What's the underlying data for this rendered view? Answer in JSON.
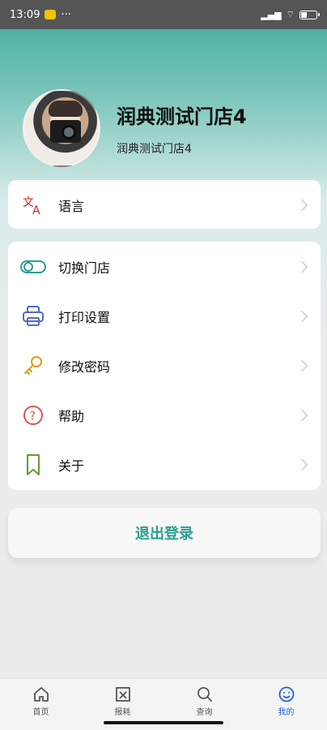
{
  "status_bar": {
    "time": "13:09",
    "dots": "···",
    "right_text": "",
    "battery_level": 0.4
  },
  "profile": {
    "title": "润典测试门店4",
    "subtitle": "润典测试门店4"
  },
  "language_item": {
    "label": "语言",
    "icon": "language-icon"
  },
  "menu": {
    "items": [
      {
        "label": "切换门店",
        "icon": "switch-icon"
      },
      {
        "label": "打印设置",
        "icon": "printer-icon"
      },
      {
        "label": "修改密码",
        "icon": "key-icon"
      },
      {
        "label": "帮助",
        "icon": "help-icon"
      },
      {
        "label": "关于",
        "icon": "bookmark-icon"
      }
    ]
  },
  "logout": {
    "label": "退出登录"
  },
  "tabbar": {
    "items": [
      {
        "label": "首页",
        "icon": "home-icon"
      },
      {
        "label": "报耗",
        "icon": "loss-icon"
      },
      {
        "label": "查询",
        "icon": "search-icon"
      },
      {
        "label": "我的",
        "icon": "profile-icon",
        "active": true
      }
    ]
  },
  "colors": {
    "accent": "#2d9d93",
    "active_tab": "#1e63d6",
    "background": "#ececec"
  }
}
